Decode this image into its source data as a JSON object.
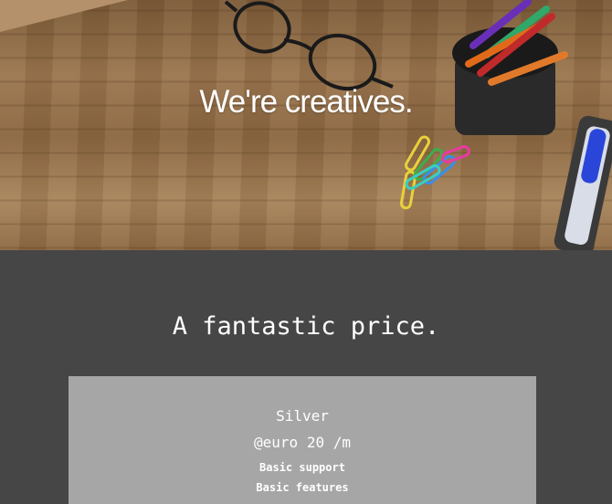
{
  "hero": {
    "headline": "We're creatives."
  },
  "pricing": {
    "heading": "A fantastic price.",
    "plan": {
      "name": "Silver",
      "price": "@euro 20 /m",
      "features": [
        "Basic support",
        "Basic features"
      ]
    }
  },
  "colors": {
    "section_background": "#464646",
    "card_background": "#a6a6a6",
    "text": "#ffffff"
  }
}
